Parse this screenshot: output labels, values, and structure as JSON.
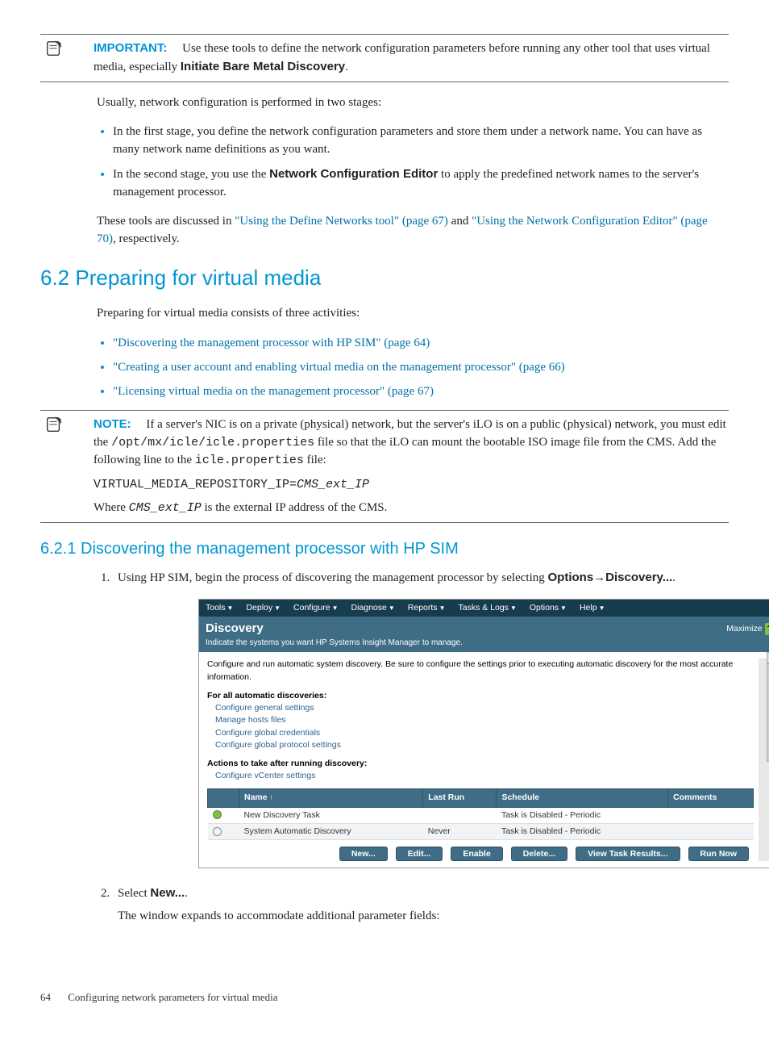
{
  "callout_important": {
    "label": "IMPORTANT:",
    "text_prefix": "Use these tools to define the network configuration parameters before running any other tool that uses virtual media, especially ",
    "bold_tail": "Initiate Bare Metal Discovery",
    "text_suffix": "."
  },
  "intro_para": "Usually, network configuration is performed in two stages:",
  "stage_bullets": [
    "In the first stage, you define the network configuration parameters and store them under a network name. You can have as many network name definitions as you want.",
    {
      "prefix": "In the second stage, you use the ",
      "bold": "Network Configuration Editor",
      "suffix": " to apply the predefined network names to the server's management processor."
    }
  ],
  "tools_para": {
    "prefix": "These tools are discussed in ",
    "link1": "\"Using the Define Networks tool\" (page 67)",
    "mid": " and ",
    "link2": "\"Using the Network Configuration Editor\" (page 70)",
    "suffix": ", respectively."
  },
  "section_6_2": "6.2 Preparing for virtual media",
  "section_6_2_intro": "Preparing for virtual media consists of three activities:",
  "activities": [
    "\"Discovering the management processor with HP SIM\" (page 64)",
    "\"Creating a user account and enabling virtual media on the management processor\" (page 66)",
    "\"Licensing virtual media on the management processor\" (page 67)"
  ],
  "callout_note": {
    "label": "NOTE:",
    "line1_prefix": "If a server's NIC is on a private (physical) network, but the server's iLO is on a public (physical) network, you must edit the ",
    "line1_mono": "/opt/mx/icle/icle.properties",
    "line1_mid": " file so that the iLO can mount the bootable ISO image file from the CMS. Add the following line to the ",
    "line1_mono2": "icle.properties",
    "line1_suffix": " file:",
    "code_line_prefix": "VIRTUAL_MEDIA_REPOSITORY_IP=",
    "code_line_var": "CMS_ext_IP",
    "line2_prefix": "Where ",
    "line2_var": "CMS_ext_IP",
    "line2_suffix": " is the external IP address of the CMS."
  },
  "section_6_2_1": "6.2.1 Discovering the management processor with HP SIM",
  "step1": {
    "prefix": "Using HP SIM, begin the process of discovering the management processor by selecting ",
    "bold_a": "Options",
    "arrow": "→",
    "bold_b": "Discovery...",
    "suffix": "."
  },
  "sim": {
    "menu": [
      "Tools",
      "Deploy",
      "Configure",
      "Diagnose",
      "Reports",
      "Tasks & Logs",
      "Options",
      "Help"
    ],
    "title": "Discovery",
    "subtitle": "Indicate the systems you want HP Systems Insight Manager to manage.",
    "maximize": "Maximize",
    "help": "?",
    "desc": "Configure and run automatic system discovery. Be sure to configure the settings prior to executing automatic discovery for the most accurate information.",
    "block1_title": "For all automatic discoveries:",
    "block1_links": [
      "Configure general settings",
      "Manage hosts files",
      "Configure global credentials",
      "Configure global protocol settings"
    ],
    "block2_title": "Actions to take after running discovery:",
    "block2_links": [
      "Configure vCenter settings"
    ],
    "table": {
      "headers": [
        "",
        "Name",
        "Last Run",
        "Schedule",
        "Comments"
      ],
      "rows": [
        {
          "selected": true,
          "name": "New Discovery Task",
          "last_run": "",
          "schedule": "Task is Disabled - Periodic",
          "comments": ""
        },
        {
          "selected": false,
          "name": "System Automatic Discovery",
          "last_run": "Never",
          "schedule": "Task is Disabled - Periodic",
          "comments": ""
        }
      ]
    },
    "buttons": [
      "New...",
      "Edit...",
      "Enable",
      "Delete...",
      "View Task Results...",
      "Run Now"
    ]
  },
  "step2": {
    "prefix": "Select ",
    "bold": "New...",
    "suffix": ".",
    "sub": "The window expands to accommodate additional parameter fields:"
  },
  "footer": {
    "page": "64",
    "title": "Configuring network parameters for virtual media"
  }
}
